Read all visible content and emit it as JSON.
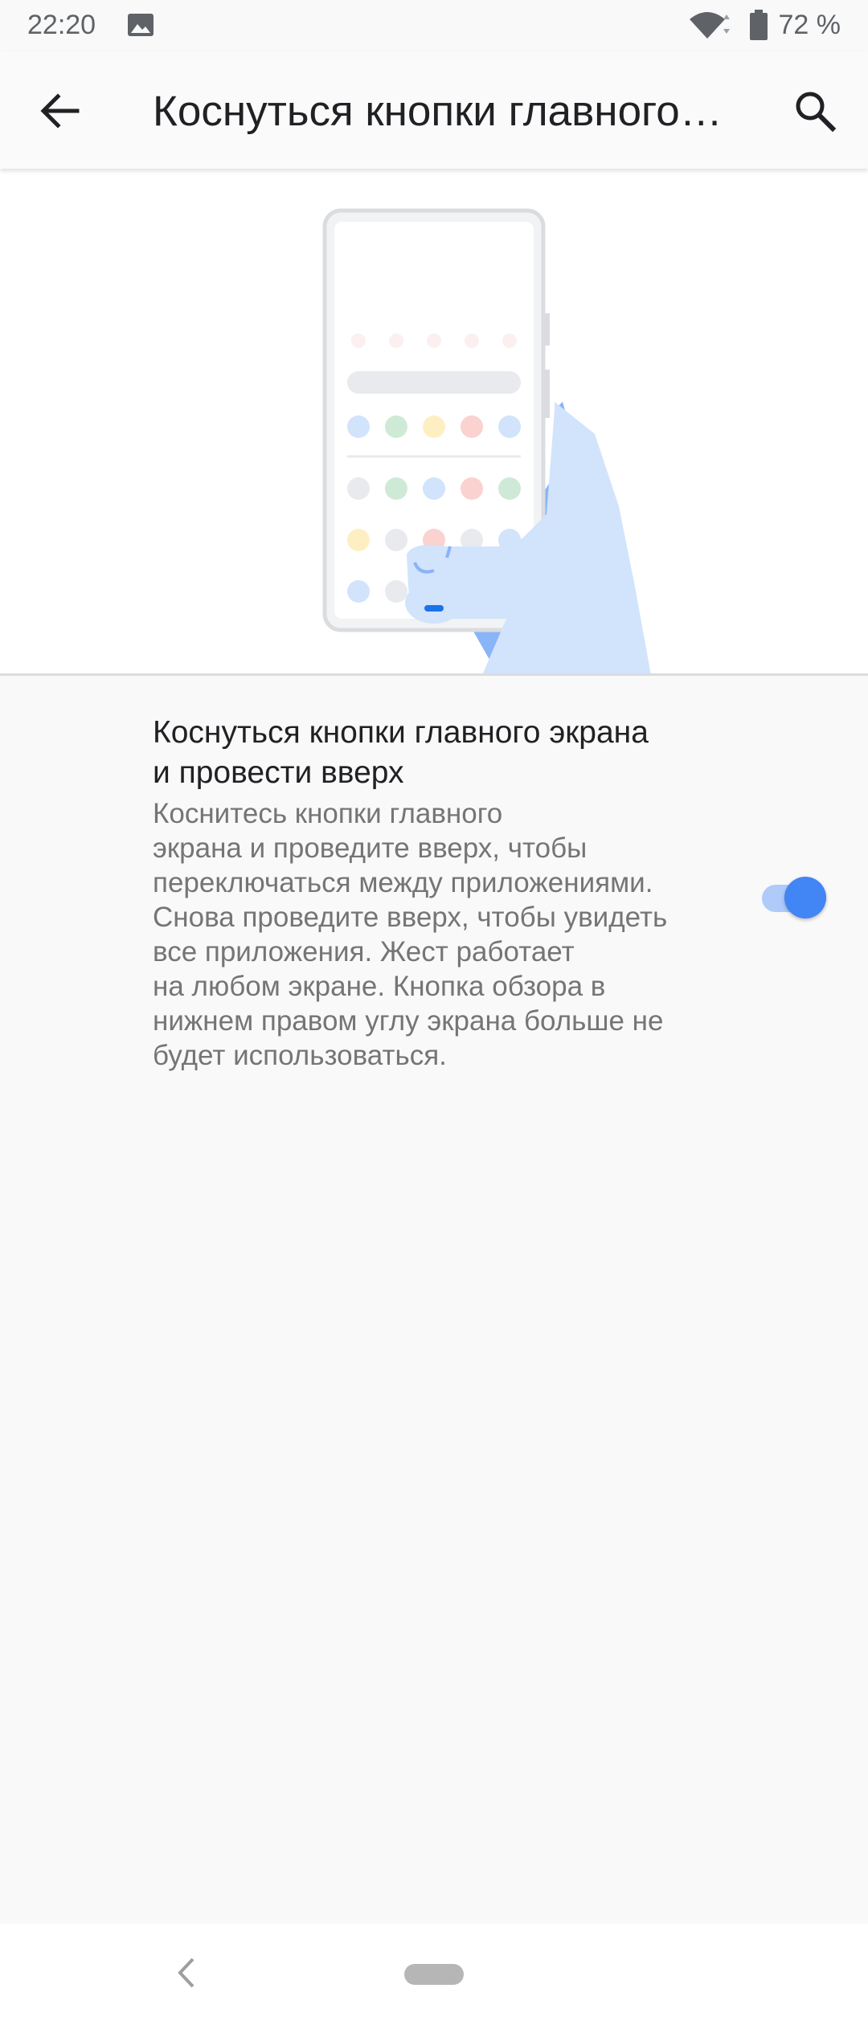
{
  "status_bar": {
    "time": "22:20",
    "battery": "72 %",
    "icons": [
      "image-icon",
      "wifi-icon",
      "battery-icon"
    ]
  },
  "app_bar": {
    "title": "Коснуться кнопки главного…",
    "back_icon": "arrow-back-icon",
    "search_icon": "search-icon"
  },
  "setting": {
    "title": "Коснуться кнопки главного экрана и провести вверх",
    "summary": "Коснитесь кнопки главного\nэкрана и проведите вверх, чтобы\nпереключаться между приложениями.\nСнова проведите вверх, чтобы увидеть\nвсе приложения. Жест работает\nна любом экране. Кнопка обзора в\nнижнем правом углу экрана больше не\nбудет использоваться.",
    "toggle_on": true
  },
  "colors": {
    "accent": "#4285f4",
    "accent_light": "#aecbfa",
    "title_text": "#202124",
    "summary_text": "#757575"
  },
  "nav_bar": {
    "back_icon": "nav-back-icon",
    "home_icon": "home-pill-icon"
  }
}
